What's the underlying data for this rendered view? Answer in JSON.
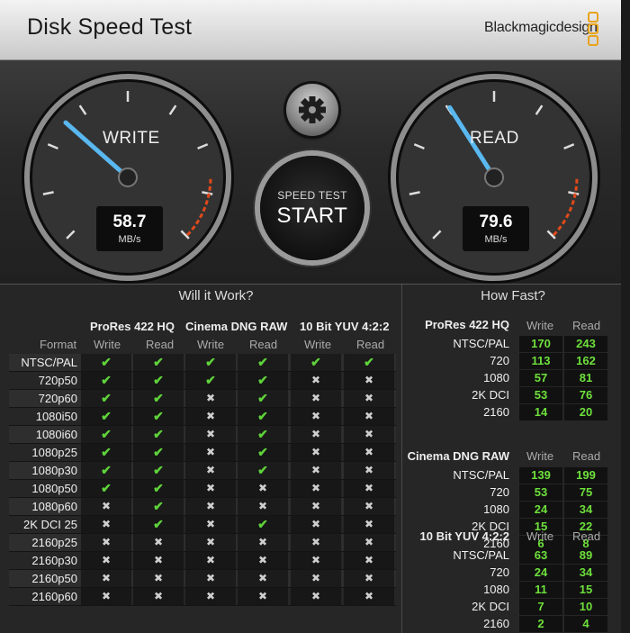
{
  "app": {
    "title": "Disk Speed Test",
    "brand": "Blackmagicdesign"
  },
  "write_gauge": {
    "label": "WRITE",
    "value": "58.7",
    "unit": "MB/s",
    "fraction": 0.32
  },
  "read_gauge": {
    "label": "READ",
    "value": "79.6",
    "unit": "MB/s",
    "fraction": 0.38
  },
  "start_button": {
    "sub": "SPEED TEST",
    "main": "START"
  },
  "will_it_work": {
    "title": "Will it Work?",
    "format_label": "Format",
    "codecs": [
      "ProRes 422 HQ",
      "Cinema DNG RAW",
      "10 Bit YUV 4:2:2"
    ],
    "col_labels": [
      "Write",
      "Read",
      "Write",
      "Read",
      "Write",
      "Read"
    ],
    "rows": [
      {
        "format": "NTSC/PAL",
        "cells": [
          1,
          1,
          1,
          1,
          1,
          1
        ]
      },
      {
        "format": "720p50",
        "cells": [
          1,
          1,
          1,
          1,
          0,
          0
        ]
      },
      {
        "format": "720p60",
        "cells": [
          1,
          1,
          0,
          1,
          0,
          0
        ]
      },
      {
        "format": "1080i50",
        "cells": [
          1,
          1,
          0,
          1,
          0,
          0
        ]
      },
      {
        "format": "1080i60",
        "cells": [
          1,
          1,
          0,
          1,
          0,
          0
        ]
      },
      {
        "format": "1080p25",
        "cells": [
          1,
          1,
          0,
          1,
          0,
          0
        ]
      },
      {
        "format": "1080p30",
        "cells": [
          1,
          1,
          0,
          1,
          0,
          0
        ]
      },
      {
        "format": "1080p50",
        "cells": [
          1,
          1,
          0,
          0,
          0,
          0
        ]
      },
      {
        "format": "1080p60",
        "cells": [
          0,
          1,
          0,
          0,
          0,
          0
        ]
      },
      {
        "format": "2K DCI 25",
        "cells": [
          0,
          1,
          0,
          1,
          0,
          0
        ]
      },
      {
        "format": "2160p25",
        "cells": [
          0,
          0,
          0,
          0,
          0,
          0
        ]
      },
      {
        "format": "2160p30",
        "cells": [
          0,
          0,
          0,
          0,
          0,
          0
        ]
      },
      {
        "format": "2160p50",
        "cells": [
          0,
          0,
          0,
          0,
          0,
          0
        ]
      },
      {
        "format": "2160p60",
        "cells": [
          0,
          0,
          0,
          0,
          0,
          0
        ]
      }
    ]
  },
  "how_fast": {
    "title": "How Fast?",
    "write_label": "Write",
    "read_label": "Read",
    "groups": [
      {
        "codec": "ProRes 422 HQ",
        "rows": [
          {
            "format": "NTSC/PAL",
            "write": "170",
            "read": "243"
          },
          {
            "format": "720",
            "write": "113",
            "read": "162"
          },
          {
            "format": "1080",
            "write": "57",
            "read": "81"
          },
          {
            "format": "2K DCI",
            "write": "53",
            "read": "76"
          },
          {
            "format": "2160",
            "write": "14",
            "read": "20"
          }
        ]
      },
      {
        "codec": "Cinema DNG RAW",
        "rows": [
          {
            "format": "NTSC/PAL",
            "write": "139",
            "read": "199"
          },
          {
            "format": "720",
            "write": "53",
            "read": "75"
          },
          {
            "format": "1080",
            "write": "24",
            "read": "34"
          },
          {
            "format": "2K DCI",
            "write": "15",
            "read": "22"
          },
          {
            "format": "2160",
            "write": "6",
            "read": "8"
          }
        ]
      },
      {
        "codec": "10 Bit YUV 4:2:2",
        "rows": [
          {
            "format": "NTSC/PAL",
            "write": "63",
            "read": "89"
          },
          {
            "format": "720",
            "write": "24",
            "read": "34"
          },
          {
            "format": "1080",
            "write": "11",
            "read": "15"
          },
          {
            "format": "2K DCI",
            "write": "7",
            "read": "10"
          },
          {
            "format": "2160",
            "write": "2",
            "read": "4"
          }
        ]
      }
    ]
  },
  "colors": {
    "ok": "#5fd33a",
    "needle": "#5ab8f0",
    "redline": "#e04a1a",
    "brand": "#e8a317"
  },
  "icons": {
    "ok": "checkmark-icon",
    "no": "cross-icon",
    "settings": "gear-icon"
  }
}
